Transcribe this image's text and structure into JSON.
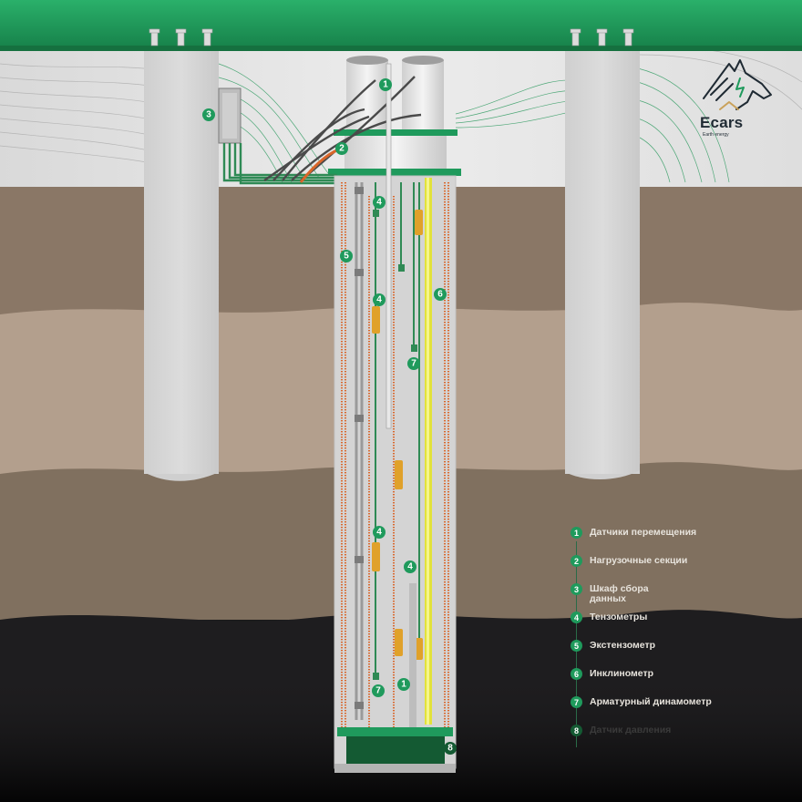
{
  "brand": {
    "name": "Ecars",
    "tagline": "Earth energy",
    "accent": "#1f9a5c"
  },
  "colors": {
    "slab": "#1f9a5c",
    "cable_green": "#2f8a55",
    "strain_gauge": "#e0a12a",
    "reinforcement": "#d9662a",
    "inclinometer": "#e2e23a",
    "soil_top": "#8a7766",
    "soil_dark": "#1e1d1f"
  },
  "legend": [
    {
      "num": "1",
      "label": "Датчики перемещения"
    },
    {
      "num": "2",
      "label": "Нагрузочные секции"
    },
    {
      "num": "3",
      "label": "Шкаф сбора данных"
    },
    {
      "num": "4",
      "label": "Тензометры"
    },
    {
      "num": "5",
      "label": "Экстензометр"
    },
    {
      "num": "6",
      "label": "Инклинометр"
    },
    {
      "num": "7",
      "label": "Арматурный динамометр"
    },
    {
      "num": "8",
      "label": "Датчик давления"
    }
  ],
  "markers": {
    "m1_top": "1",
    "m2": "2",
    "m3": "3",
    "m4_a": "4",
    "m4_b": "4",
    "m4_c": "4",
    "m4_d": "4",
    "m5": "5",
    "m6": "6",
    "m7_a": "7",
    "m7_b": "7",
    "m1_bottom": "1",
    "m8": "8"
  }
}
